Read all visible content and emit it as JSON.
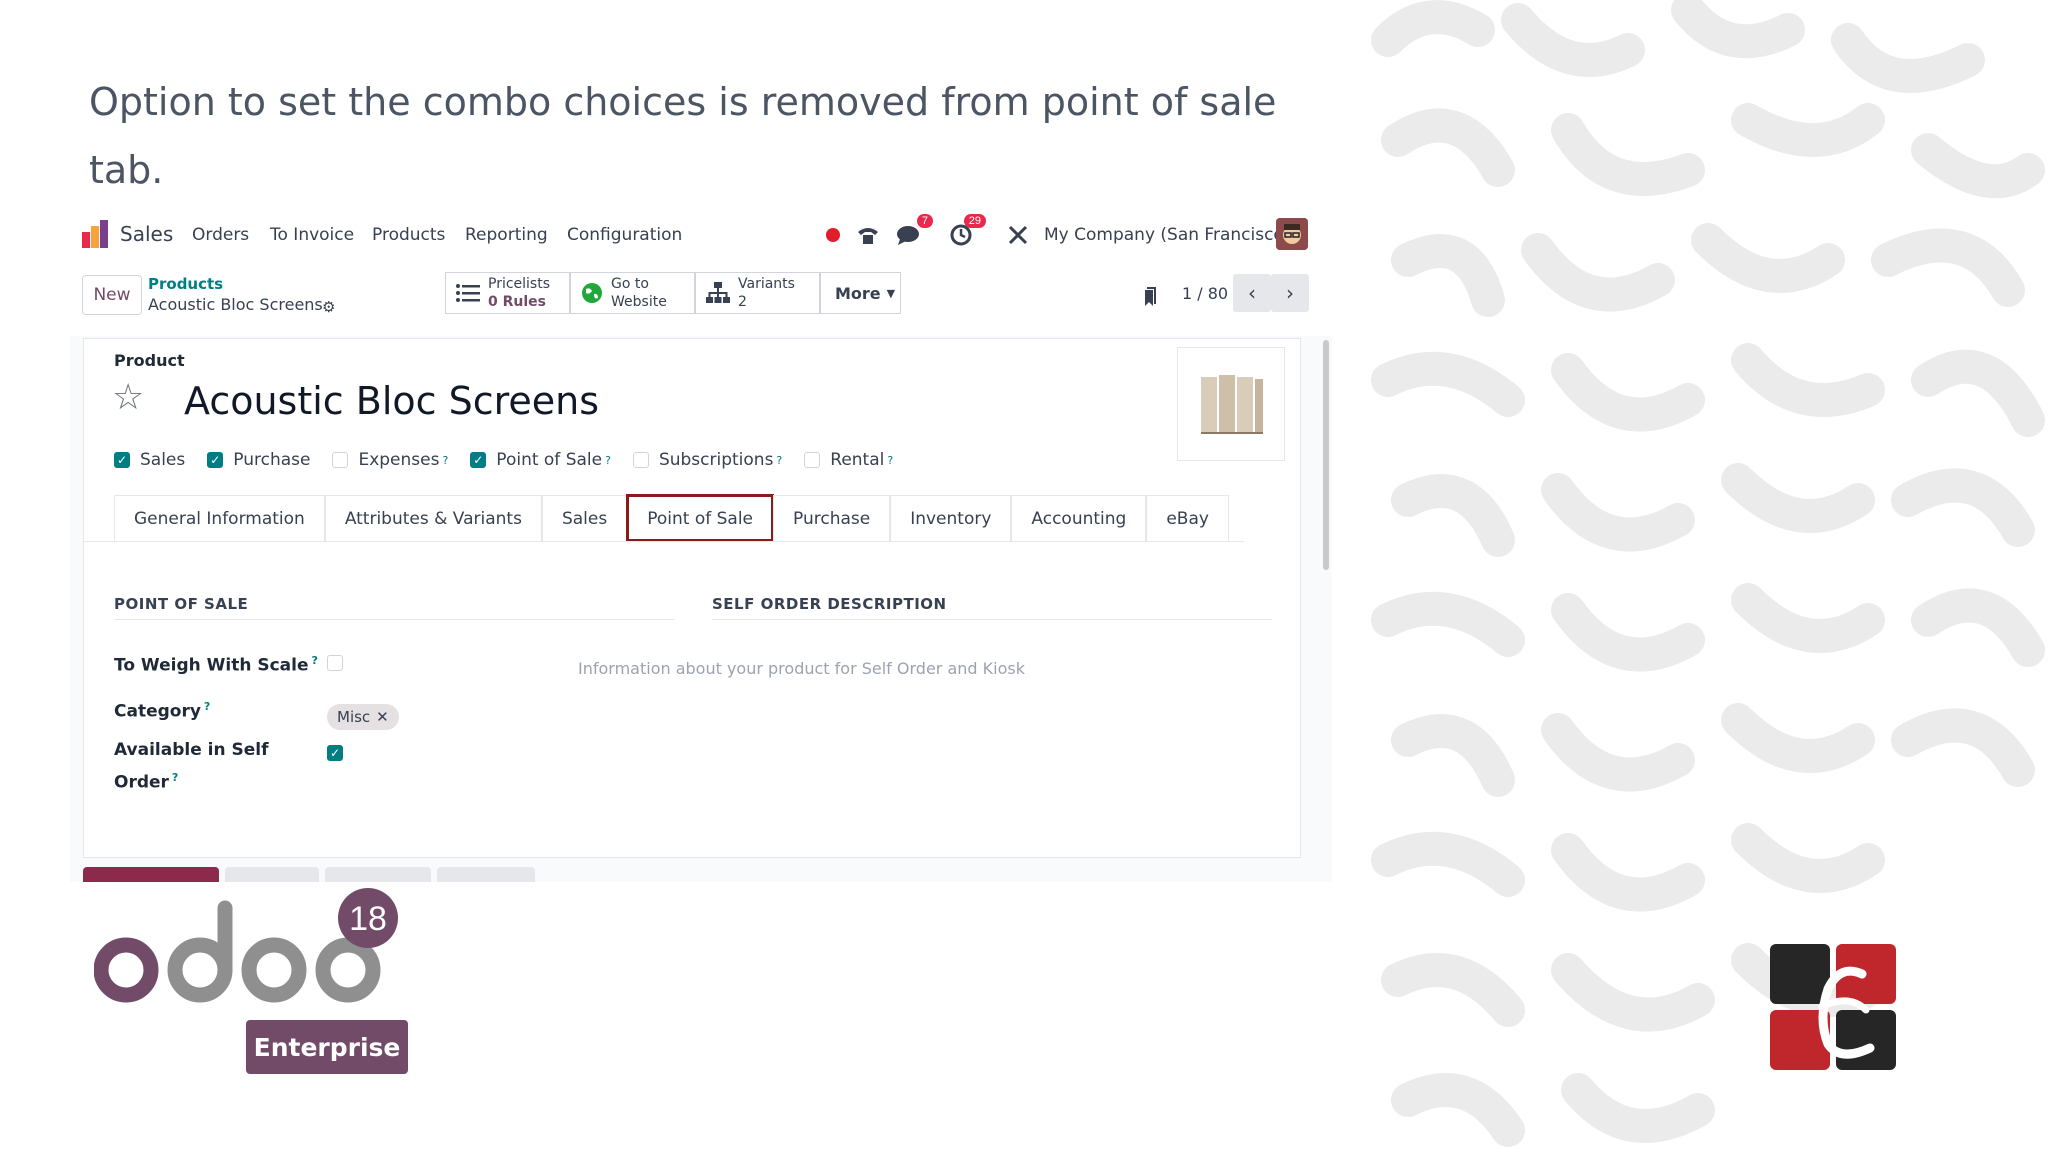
{
  "headline": "Option to set the combo choices is removed from point of sale tab.",
  "topbar": {
    "app_name": "Sales",
    "menu": [
      "Orders",
      "To Invoice",
      "Products",
      "Reporting",
      "Configuration"
    ],
    "chat_badge": "7",
    "activity_badge": "29",
    "company": "My Company (San Francisco)"
  },
  "control": {
    "new_label": "New",
    "breadcrumb_parent": "Products",
    "breadcrumb_current": "Acoustic Bloc Screens",
    "smart_buttons": [
      {
        "title": "Pricelists",
        "sub": "0 Rules",
        "icon": "list-icon"
      },
      {
        "title": "Go to",
        "sub": "Website",
        "icon": "globe-icon"
      },
      {
        "title": "Variants",
        "sub": "2",
        "icon": "sitemap-icon"
      }
    ],
    "more_label": "More",
    "pager": "1 / 80"
  },
  "form": {
    "section_label": "Product",
    "product_name": "Acoustic Bloc Screens",
    "checkboxes": [
      {
        "label": "Sales",
        "checked": true,
        "help": false
      },
      {
        "label": "Purchase",
        "checked": true,
        "help": false
      },
      {
        "label": "Expenses",
        "checked": false,
        "help": true
      },
      {
        "label": "Point of Sale",
        "checked": true,
        "help": true
      },
      {
        "label": "Subscriptions",
        "checked": false,
        "help": true
      },
      {
        "label": "Rental",
        "checked": false,
        "help": true
      }
    ],
    "tabs": [
      "General Information",
      "Attributes & Variants",
      "Sales",
      "Point of Sale",
      "Purchase",
      "Inventory",
      "Accounting",
      "eBay"
    ],
    "active_tab": "Point of Sale",
    "pos_section": "POINT OF SALE",
    "self_order_section": "SELF ORDER DESCRIPTION",
    "fields": {
      "weigh_label": "To Weigh With Scale",
      "weigh_checked": false,
      "category_label": "Category",
      "category_tag": "Misc",
      "self_order_label_1": "Available in Self",
      "self_order_label_2": "Order",
      "self_order_checked": true
    },
    "self_order_placeholder": "Information about your product for Self Order and Kiosk",
    "help_mark": "?"
  },
  "branding": {
    "odoo_version": "18",
    "edition": "Enterprise",
    "accent": "#714B67"
  }
}
